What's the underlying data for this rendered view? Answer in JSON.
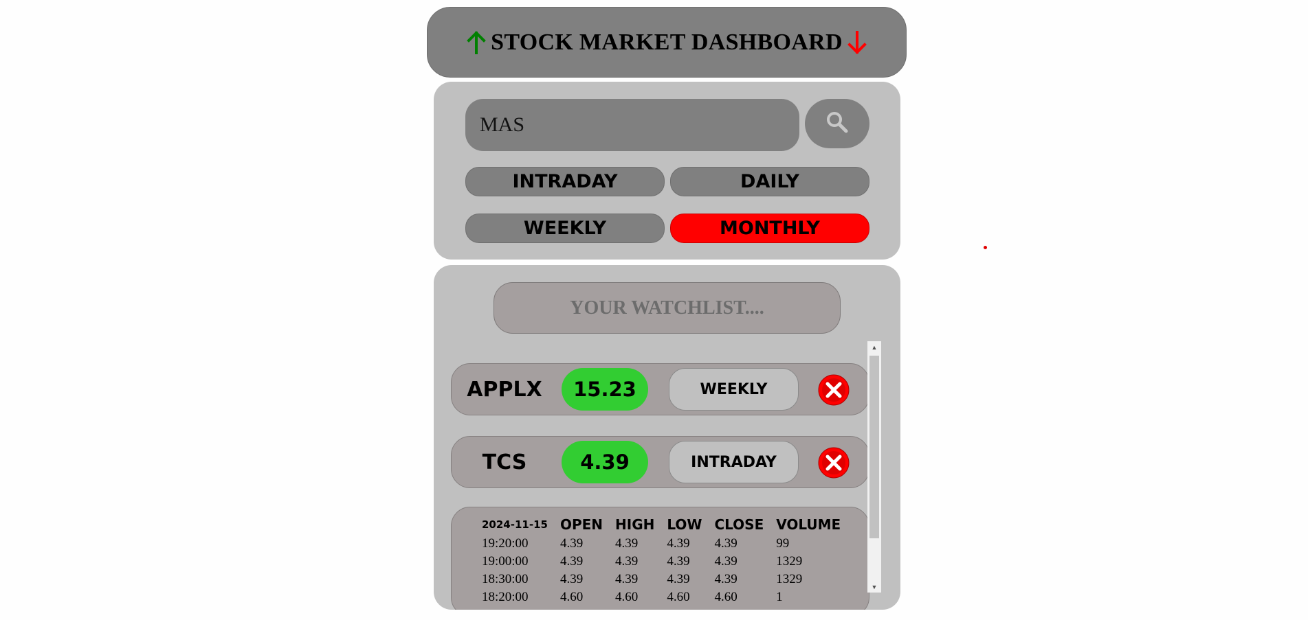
{
  "header": {
    "title": "STOCK MARKET DASHBOARD",
    "up_icon": "arrow-up-icon",
    "down_icon": "arrow-down-icon",
    "up_color": "#008000",
    "down_color": "#ff0000"
  },
  "search": {
    "value": "MAS",
    "button_icon": "search-icon"
  },
  "filters": {
    "intraday": "INTRADAY",
    "daily": "DAILY",
    "weekly": "WEEKLY",
    "monthly": "MONTHLY",
    "active": "MONTHLY",
    "active_color": "#ff0000"
  },
  "watchlist": {
    "title": "YOUR WATCHLIST....",
    "items": [
      {
        "ticker": "APPLX",
        "price": "15.23",
        "interval": "WEEKLY",
        "remove_icon": "close-icon"
      },
      {
        "ticker": "TCS",
        "price": "4.39",
        "interval": "INTRADAY",
        "remove_icon": "close-icon"
      }
    ],
    "price_color": "#32cd32"
  },
  "table": {
    "date": "2024-11-15",
    "headers": [
      "OPEN",
      "HIGH",
      "LOW",
      "CLOSE",
      "VOLUME"
    ],
    "rows": [
      [
        "19:20:00",
        "4.39",
        "4.39",
        "4.39",
        "4.39",
        "99"
      ],
      [
        "19:00:00",
        "4.39",
        "4.39",
        "4.39",
        "4.39",
        "1329"
      ],
      [
        "18:30:00",
        "4.39",
        "4.39",
        "4.39",
        "4.39",
        "1329"
      ],
      [
        "18:20:00",
        "4.60",
        "4.60",
        "4.60",
        "4.60",
        "1"
      ]
    ]
  }
}
